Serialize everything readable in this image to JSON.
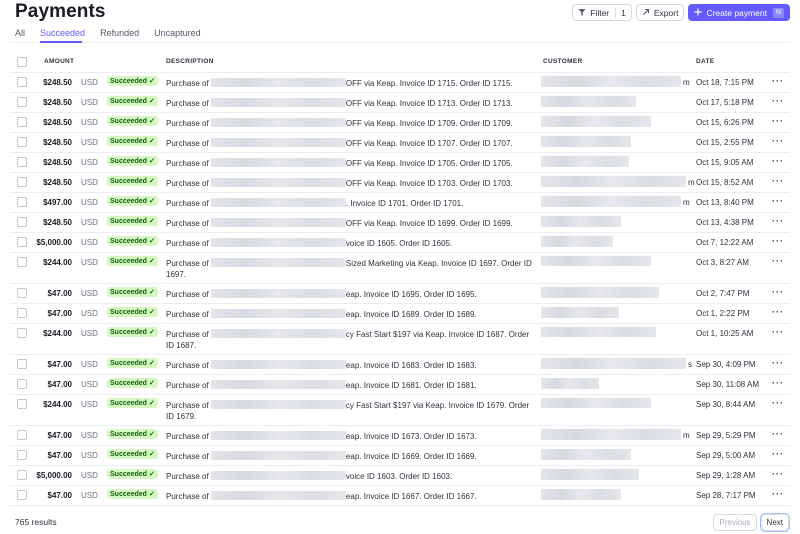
{
  "page": {
    "title": "Payments"
  },
  "tabs": [
    {
      "label": "All",
      "active": false
    },
    {
      "label": "Succeeded",
      "active": true
    },
    {
      "label": "Refunded",
      "active": false
    },
    {
      "label": "Uncaptured",
      "active": false
    }
  ],
  "toolbar": {
    "filter_label": "Filter",
    "filter_count": "1",
    "export_label": "Export",
    "create_label": "Create payment",
    "create_shortcut": "N"
  },
  "columns": {
    "amount": "AMOUNT",
    "description": "DESCRIPTION",
    "customer": "CUSTOMER",
    "date": "DATE"
  },
  "rows": [
    {
      "amount": "$248.50",
      "currency": "USD",
      "status": "Succeeded",
      "desc_pre": "Purchase of ",
      "desc_post": "OFF via Keap. Invoice ID 1715. Order ID 1715.",
      "cust_tail": "m",
      "date": "Oct 18, 7:15 PM"
    },
    {
      "amount": "$248.50",
      "currency": "USD",
      "status": "Succeeded",
      "desc_pre": "Purchase of ",
      "desc_post": "OFF via Keap. Invoice ID 1713. Order ID 1713.",
      "cust_tail": "",
      "date": "Oct 17, 5:18 PM"
    },
    {
      "amount": "$248.50",
      "currency": "USD",
      "status": "Succeeded",
      "desc_pre": "Purchase of ",
      "desc_post": "OFF via Keap. Invoice ID 1709. Order ID 1709.",
      "cust_tail": "",
      "date": "Oct 15, 6:26 PM"
    },
    {
      "amount": "$248.50",
      "currency": "USD",
      "status": "Succeeded",
      "desc_pre": "Purchase of ",
      "desc_post": "OFF via Keap. Invoice ID 1707. Order ID 1707.",
      "cust_tail": "",
      "date": "Oct 15, 2:55 PM"
    },
    {
      "amount": "$248.50",
      "currency": "USD",
      "status": "Succeeded",
      "desc_pre": "Purchase of ",
      "desc_post": "OFF via Keap. Invoice ID 1705. Order ID 1705.",
      "cust_tail": "",
      "date": "Oct 15, 9:05 AM"
    },
    {
      "amount": "$248.50",
      "currency": "USD",
      "status": "Succeeded",
      "desc_pre": "Purchase of ",
      "desc_post": "OFF via Keap. Invoice ID 1703. Order ID 1703.",
      "cust_tail": "m",
      "date": "Oct 15, 8:52 AM"
    },
    {
      "amount": "$497.00",
      "currency": "USD",
      "status": "Succeeded",
      "desc_pre": "Purchase of ",
      "desc_post": ". Invoice ID 1701. Order ID 1701.",
      "cust_tail": "m",
      "date": "Oct 13, 8:40 PM"
    },
    {
      "amount": "$248.50",
      "currency": "USD",
      "status": "Succeeded",
      "desc_pre": "Purchase of ",
      "desc_post": "OFF via Keap. Invoice ID 1699. Order ID 1699.",
      "cust_tail": "",
      "date": "Oct 13, 4:38 PM"
    },
    {
      "amount": "$5,000.00",
      "currency": "USD",
      "status": "Succeeded",
      "desc_pre": "Purchase of ",
      "desc_post": "voice ID 1605. Order ID 1605.",
      "cust_tail": "",
      "date": "Oct 7, 12:22 AM"
    },
    {
      "amount": "$244.00",
      "currency": "USD",
      "status": "Succeeded",
      "desc_pre": "Purchase of ",
      "desc_post": "Sized Marketing via Keap. Invoice ID 1697. Order ID",
      "desc_line2": "1697.",
      "cust_tail": "",
      "date": "Oct 3, 8:27 AM"
    },
    {
      "amount": "$47.00",
      "currency": "USD",
      "status": "Succeeded",
      "desc_pre": "Purchase of ",
      "desc_post": "eap. Invoice ID 1695. Order ID 1695.",
      "cust_tail": "",
      "date": "Oct 2, 7:47 PM"
    },
    {
      "amount": "$47.00",
      "currency": "USD",
      "status": "Succeeded",
      "desc_pre": "Purchase of ",
      "desc_post": "eap. Invoice ID 1689. Order ID 1689.",
      "cust_tail": "",
      "date": "Oct 1, 2:22 PM"
    },
    {
      "amount": "$244.00",
      "currency": "USD",
      "status": "Succeeded",
      "desc_pre": "Purchase of ",
      "desc_post": "cy Fast Start $197 via Keap. Invoice ID 1687. Order",
      "desc_line2": "ID 1687.",
      "cust_tail": "",
      "date": "Oct 1, 10:25 AM"
    },
    {
      "amount": "$47.00",
      "currency": "USD",
      "status": "Succeeded",
      "desc_pre": "Purchase of ",
      "desc_post": "eap. Invoice ID 1683. Order ID 1683.",
      "cust_tail": "s",
      "date": "Sep 30, 4:09 PM"
    },
    {
      "amount": "$47.00",
      "currency": "USD",
      "status": "Succeeded",
      "desc_pre": "Purchase of ",
      "desc_post": "eap. Invoice ID 1681. Order ID 1681.",
      "cust_tail": "",
      "date": "Sep 30, 11:08 AM"
    },
    {
      "amount": "$244.00",
      "currency": "USD",
      "status": "Succeeded",
      "desc_pre": "Purchase of ",
      "desc_post": "cy Fast Start $197 via Keap. Invoice ID 1679. Order",
      "desc_line2": "ID 1679.",
      "cust_tail": "",
      "date": "Sep 30, 8:44 AM"
    },
    {
      "amount": "$47.00",
      "currency": "USD",
      "status": "Succeeded",
      "desc_pre": "Purchase of ",
      "desc_post": "eap. Invoice ID 1673. Order ID 1673.",
      "cust_tail": "m",
      "date": "Sep 29, 5:29 PM"
    },
    {
      "amount": "$47.00",
      "currency": "USD",
      "status": "Succeeded",
      "desc_pre": "Purchase of ",
      "desc_post": "eap. Invoice ID 1669. Order ID 1669.",
      "cust_tail": "",
      "date": "Sep 29, 5:00 AM"
    },
    {
      "amount": "$5,000.00",
      "currency": "USD",
      "status": "Succeeded",
      "desc_pre": "Purchase of ",
      "desc_post": "voice ID 1603. Order ID 1603.",
      "cust_tail": "",
      "date": "Sep 29, 1:28 AM"
    },
    {
      "amount": "$47.00",
      "currency": "USD",
      "status": "Succeeded",
      "desc_pre": "Purchase of ",
      "desc_post": "eap. Invoice ID 1667. Order ID 1667.",
      "cust_tail": "",
      "date": "Sep 28, 7:17 PM"
    }
  ],
  "footer": {
    "results": "765 results",
    "previous_label": "Previous",
    "next_label": "Next"
  },
  "colors": {
    "accent": "#635bff",
    "success_bg": "#d7f7c2",
    "success_text": "#05690d"
  }
}
